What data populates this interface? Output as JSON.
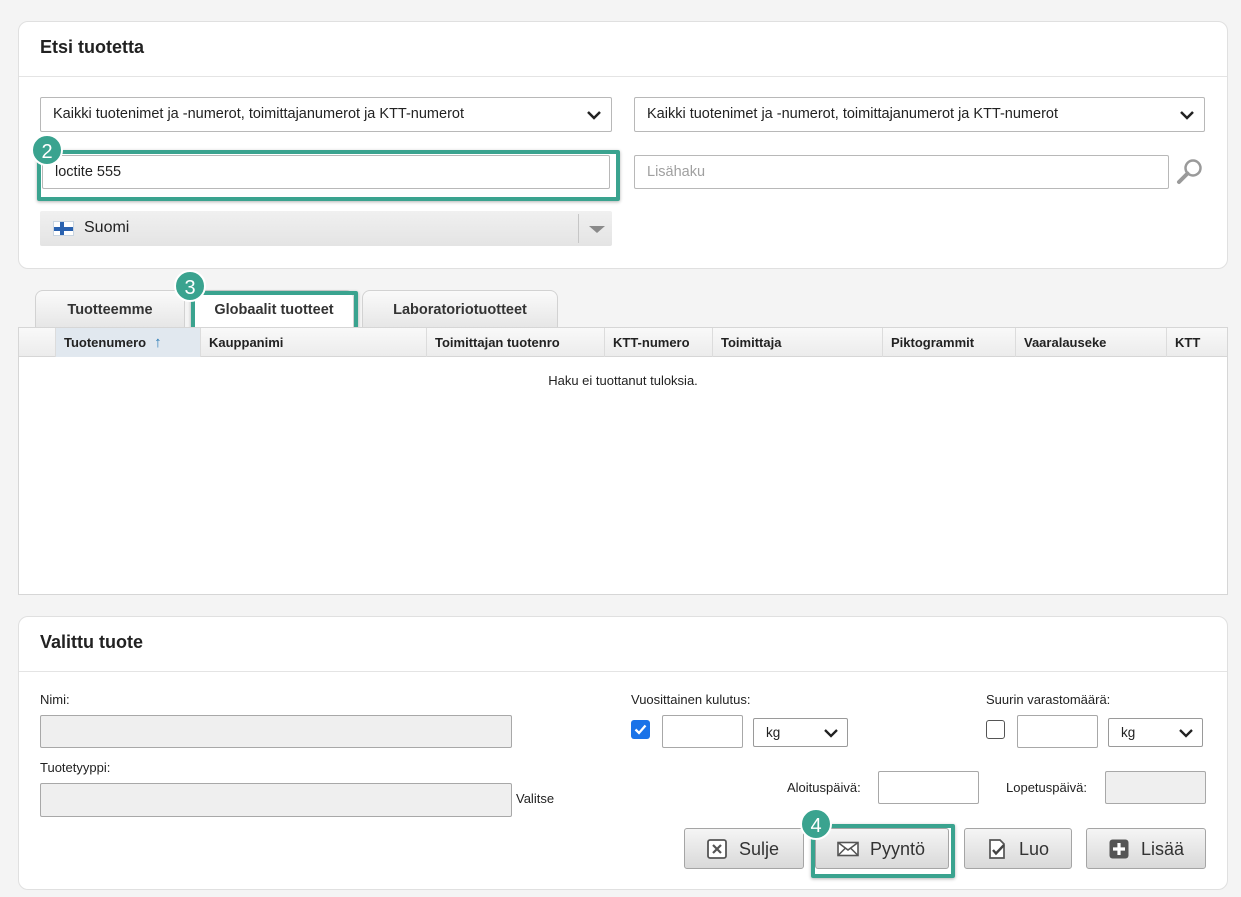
{
  "search_panel": {
    "title": "Etsi tuotetta",
    "scope_select_1": "Kaikki tuotenimet ja -numerot, toimittajanumerot ja KTT-numerot",
    "scope_select_2": "Kaikki tuotenimet ja -numerot, toimittajanumerot ja KTT-numerot",
    "search_value": "loctite 555",
    "extra_search_placeholder": "Lisähaku",
    "language": "Suomi"
  },
  "badges": {
    "step2": "2",
    "step3": "3",
    "step4": "4"
  },
  "tabs": [
    {
      "label": "Tuotteemme"
    },
    {
      "label": "Globaalit tuotteet"
    },
    {
      "label": "Laboratoriotuotteet"
    }
  ],
  "grid": {
    "columns": [
      "Tuotenumero",
      "Kauppanimi",
      "Toimittajan tuotenro",
      "KTT-numero",
      "Toimittaja",
      "Piktogrammit",
      "Vaaralauseke",
      "KTT"
    ],
    "sort_indicator": "↑",
    "empty_message": "Haku ei tuottanut tuloksia."
  },
  "selected_panel": {
    "title": "Valittu tuote",
    "name_label": "Nimi:",
    "type_label": "Tuotetyyppi:",
    "choose_link": "Valitse",
    "annual_usage_label": "Vuosittainen kulutus:",
    "annual_usage_checked": true,
    "annual_unit": "kg",
    "max_storage_label": "Suurin varastomäärä:",
    "max_storage_checked": false,
    "max_unit": "kg",
    "start_date_label": "Aloituspäivä:",
    "end_date_label": "Lopetuspäivä:"
  },
  "buttons": {
    "close": "Sulje",
    "request": "Pyyntö",
    "create": "Luo",
    "add": "Lisää"
  },
  "colors": {
    "highlight": "#3aa38f",
    "checkbox": "#1a73e8",
    "sort_arrow": "#2a7ab5"
  },
  "icons": [
    "chevron-down-icon",
    "magnifier-icon",
    "finland-flag-icon",
    "close-x-icon",
    "envelope-icon",
    "document-check-icon",
    "plus-icon"
  ]
}
